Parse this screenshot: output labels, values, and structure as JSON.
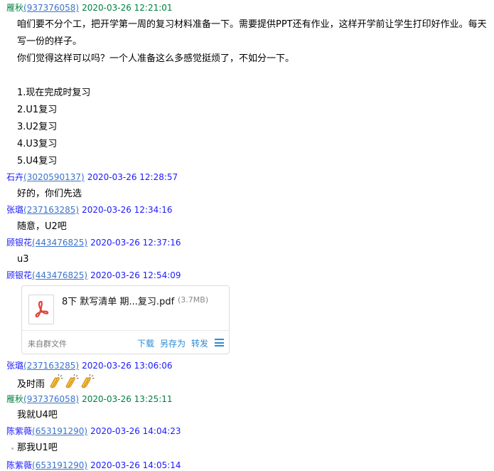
{
  "messages": [
    {
      "sender": "雁秋",
      "qq": "(937376058)",
      "time": "2020-03-26 12:21:01",
      "lines": [
        "咱们要不分个工，把开学第一周的复习材料准备一下。需要提供PPT还有作业，这样开学前让学生打印好作业。每天",
        "写一份的样子。",
        "你们觉得这样可以吗？一个人准备这么多感觉挺烦了，不如分一下。",
        "",
        "1.现在完成时复习",
        "2.U1复习",
        "3.U2复习",
        "4.U3复习",
        "5.U4复习"
      ]
    },
    {
      "sender": "石卉",
      "qq": "(3020590137)",
      "time": "2020-03-26 12:28:57",
      "lines": [
        "好的，你们先选"
      ]
    },
    {
      "sender": "张璐",
      "qq": "(237163285)",
      "time": "2020-03-26 12:34:16",
      "lines": [
        "随意，U2吧"
      ]
    },
    {
      "sender": "顾银花",
      "qq": "(443476825)",
      "time": "2020-03-26 12:37:16",
      "lines": [
        "u3"
      ]
    },
    {
      "sender": "顾银花",
      "qq": "(443476825)",
      "time": "2020-03-26 12:54:09"
    },
    {
      "sender": "张璐",
      "qq": "(237163285)",
      "time": "2020-03-26 13:06:06",
      "lines": [
        "及时雨"
      ]
    },
    {
      "sender": "雁秋",
      "qq": "(937376058)",
      "time": "2020-03-26 13:25:11",
      "lines": [
        "我就U4吧"
      ]
    },
    {
      "sender": "陈紫薇",
      "qq": "(653191290)",
      "time": "2020-03-26 14:04:23",
      "lines": [
        "那我U1吧"
      ]
    },
    {
      "sender": "陈紫薇",
      "qq": "(653191290)",
      "time": "2020-03-26 14:05:14"
    }
  ],
  "file": {
    "name": "8下 默写清单 期...复习.pdf",
    "size": "(3.7MB)",
    "source": "来自群文件",
    "actions": {
      "download": "下载",
      "save_as": "另存为",
      "forward": "转发"
    },
    "icon": "pdf-icon"
  },
  "emoji": {
    "name": "clapping-hands-icon",
    "count": 3
  },
  "colors": {
    "sender_green": "#008040",
    "sender_blue": "#1a1aff",
    "link": "#3c74c9",
    "action": "#2a8bd6",
    "pdf_red": "#e0443a"
  }
}
